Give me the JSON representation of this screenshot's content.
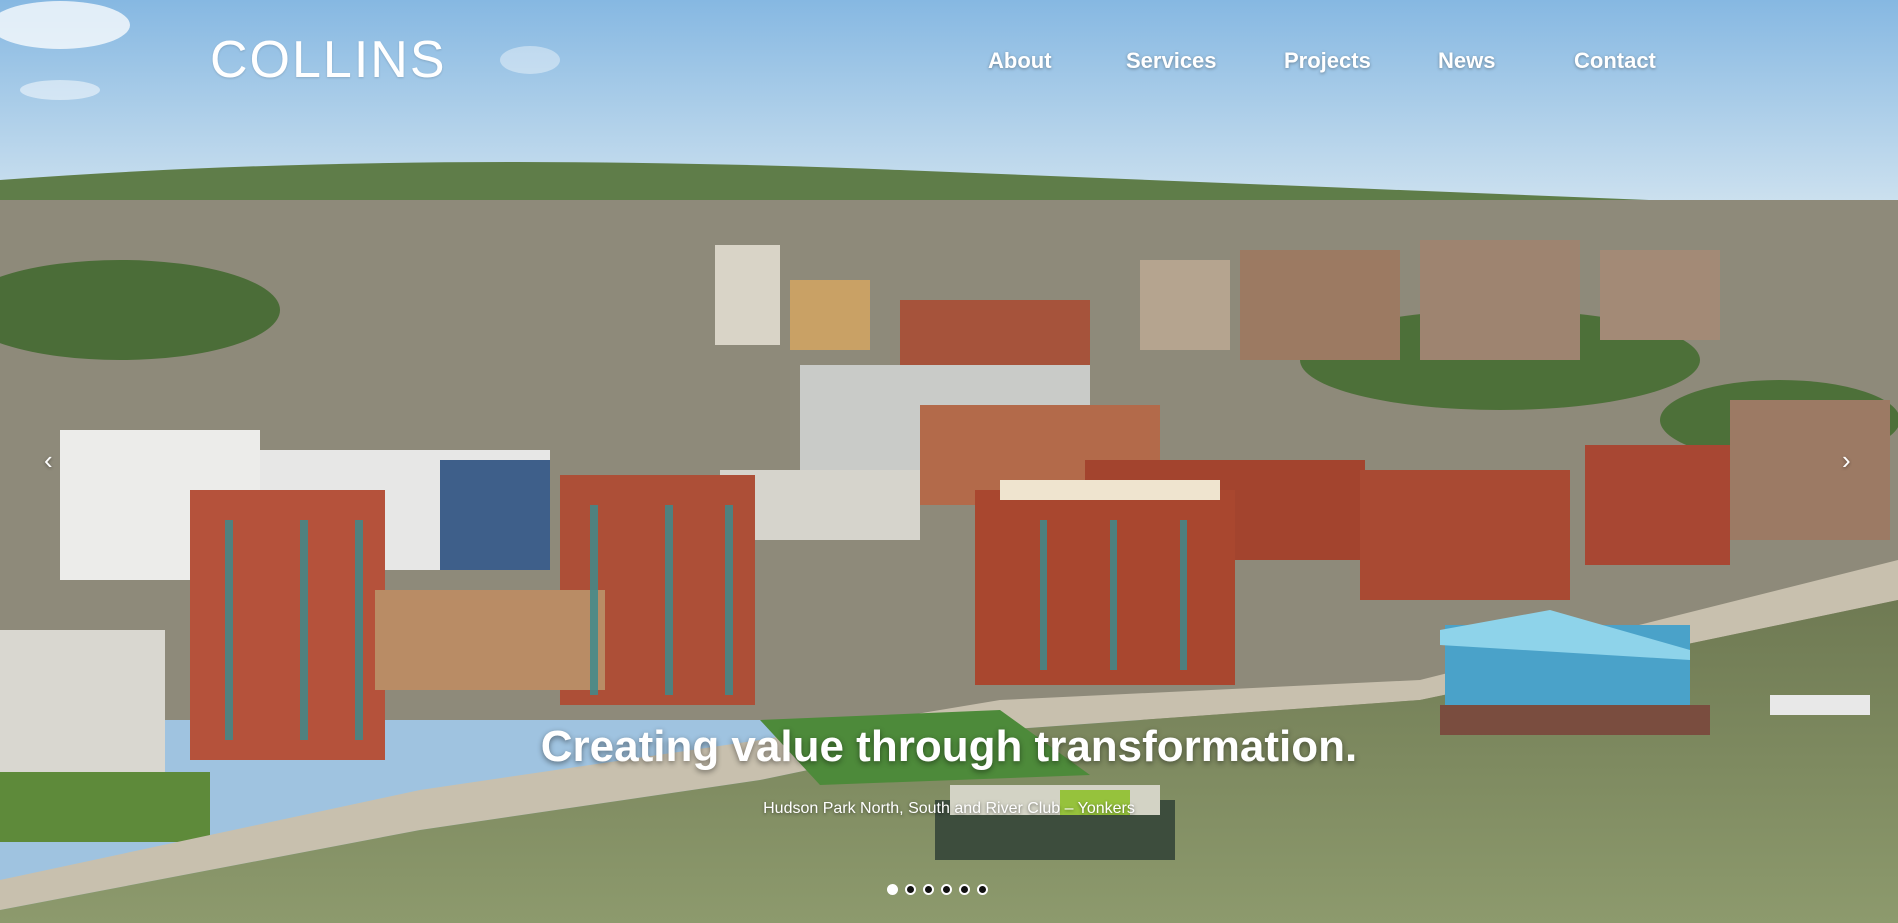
{
  "brand": {
    "logo_text": "COLLINS"
  },
  "nav": {
    "items": [
      {
        "label": "About"
      },
      {
        "label": "Services"
      },
      {
        "label": "Projects"
      },
      {
        "label": "News"
      },
      {
        "label": "Contact"
      }
    ]
  },
  "slider": {
    "headline": "Creating value through transformation.",
    "caption": "Hudson Park North, South and River Club – Yonkers",
    "prev_glyph": "‹",
    "next_glyph": "›",
    "slide_count": 6,
    "active_slide": 1
  },
  "colors": {
    "sky": "#a9cdea",
    "water": "#7c8a5f",
    "brick": "#a34b33",
    "text": "#ffffff"
  }
}
